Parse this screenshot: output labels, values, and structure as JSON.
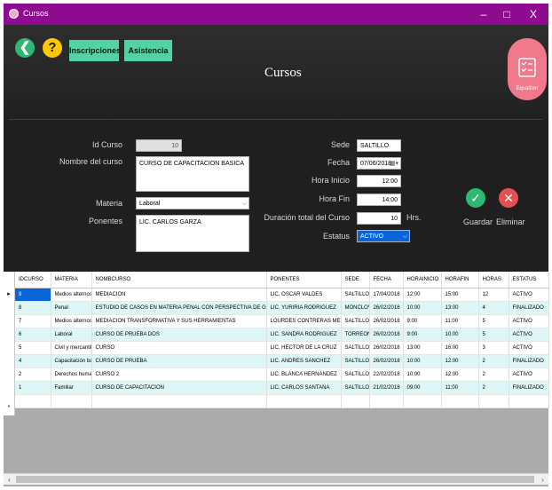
{
  "window": {
    "title": "Cursos",
    "minimize": "–",
    "maximize": "□",
    "close": "X"
  },
  "header": {
    "back_icon": "back-arrow-icon",
    "back_glyph": "❮",
    "help_icon": "help-icon",
    "help_glyph": "?",
    "nav_inscripciones": "Inscripciones",
    "nav_asistencia": "Asistencia",
    "page_title": "Cursos",
    "equalizer_label": "Equalizer"
  },
  "form": {
    "id_curso_label": "Id Curso",
    "id_curso_value": "10",
    "nombre_label": "Nombre del curso",
    "nombre_value": "CURSO DE CAPACITACION BASICA",
    "materia_label": "Materia",
    "materia_value": "Laboral",
    "ponentes_label": "Ponentes",
    "ponentes_value": "LIC. CARLOS GARZA",
    "sede_label": "Sede",
    "sede_value": "SALTILLO",
    "fecha_label": "Fecha",
    "fecha_value": "07/06/2018",
    "hora_inicio_label": "Hora Inicio",
    "hora_inicio_value": "12:00",
    "hora_fin_label": "Hora Fin",
    "hora_fin_value": "14:00",
    "duracion_label": "Duración total del Curso",
    "duracion_value": "10",
    "duracion_unit": "Hrs.",
    "estatus_label": "Estatus",
    "estatus_value": "ACTIVO"
  },
  "actions": {
    "guardar_label": "Guardar",
    "guardar_glyph": "✓",
    "eliminar_label": "Eliminar",
    "eliminar_glyph": "✕"
  },
  "grid": {
    "columns": [
      "IDCURSO",
      "MATERIA",
      "NOMBCURSO",
      "PONENTES",
      "SEDE",
      "FECHA",
      "HORAINICIO",
      "HORAFIN",
      "HORAS",
      "ESTATUS"
    ],
    "rows": [
      [
        "9",
        "Medios alternos",
        "MEDIACION",
        "LIC. OSCAR VALDES",
        "SALTILLO",
        "17/04/2018",
        "12:00",
        "15:00",
        "12",
        "ACTIVO"
      ],
      [
        "8",
        "Penal",
        "ESTUDIO DE CASOS EN MATERIA PENAL CON PERSPECTIVA DE GENERO",
        "LIC. YURIRIA RODRIGUEZ",
        "MONCLOVA",
        "26/02/2018",
        "10:00",
        "13:00",
        "4",
        "FINALIZADO"
      ],
      [
        "7",
        "Medios alternos",
        "MEDIACION TRANSFORMATIVA Y SUS HERRAMIENTAS",
        "LOURDES CONTRERAS MESTA",
        "SALTILLO",
        "26/02/2018",
        "9:00",
        "11:00",
        "5",
        "ACTIVO"
      ],
      [
        "6",
        "Laboral",
        "CURSO DE PRUEBA DOS",
        "LIC. SANDRA RODRIGUEZ",
        "TORREON",
        "26/02/2018",
        "9:00",
        "10:00",
        "5",
        "ACTIVO"
      ],
      [
        "5",
        "Civil y mercantil",
        "CURSO",
        "LIC. HECTOR DE LA CRUZ",
        "SALTILLO",
        "26/02/2018",
        "13:00",
        "16:00",
        "3",
        "ACTIVO"
      ],
      [
        "4",
        "Capacitación básica",
        "CURSO DE PRUEBA",
        "LIC. ANDRES SANCHEZ",
        "SALTILLO",
        "26/02/2018",
        "10:00",
        "12:00",
        "2",
        "FINALIZADO"
      ],
      [
        "2",
        "Derechos humanos",
        "CURSO 2",
        "LIC. BLANCA HERNANDEZ",
        "SALTILLO",
        "22/02/2018",
        "10:00",
        "12:00",
        "2",
        "ACTIVO"
      ],
      [
        "1",
        "Familiar",
        "CURSO DE CAPACITACION",
        "LIC. CARLOS SANTANA",
        "SALTILLO",
        "21/02/2018",
        "09:00",
        "11:00",
        "2",
        "FINALIZADO"
      ]
    ],
    "current_row_marker": "▸",
    "new_row_marker": "*"
  },
  "colors": {
    "titlebar": "#8e0a8e",
    "nav_button": "#53d3a3",
    "accent_green": "#2eb872",
    "accent_yellow": "#ffc800",
    "accent_red": "#e85050",
    "selection_blue": "#0a64d8",
    "row_alt": "#dff6f6"
  }
}
